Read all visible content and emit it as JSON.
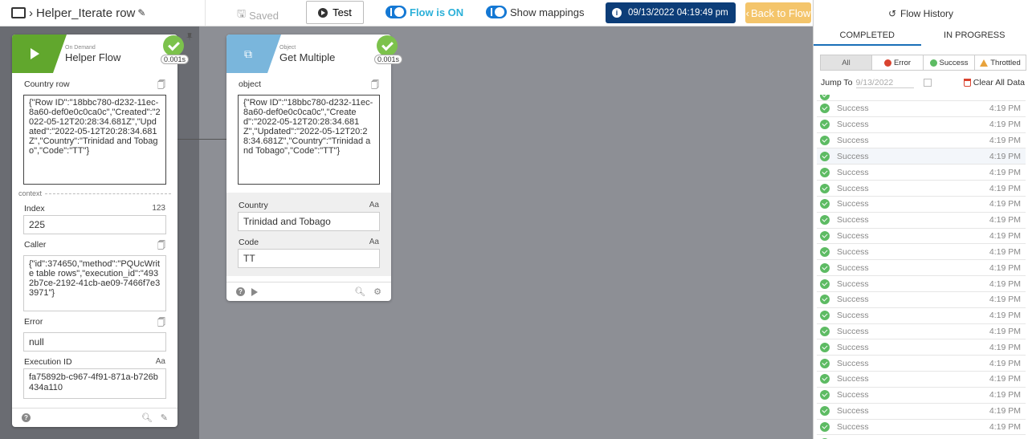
{
  "toolbar": {
    "flow_name": "Helper_Iterate row",
    "saved_label": "Saved",
    "test_label": "Test",
    "flow_on_label": "Flow is ON",
    "show_mappings_label": "Show mappings",
    "timestamp": "09/13/2022 04:19:49 pm",
    "back_label": "Back to Flow"
  },
  "cards": {
    "helper": {
      "subtitle": "On Demand",
      "title": "Helper Flow",
      "duration": "0.001s",
      "country_row_label": "Country row",
      "country_row_value": "{\"Row ID\":\"18bbc780-d232-11ec-8a60-def0e0c0ca0c\",\"Created\":\"2022-05-12T20:28:34.681Z\",\"Updated\":\"2022-05-12T20:28:34.681Z\",\"Country\":\"Trinidad and Tobago\",\"Code\":\"TT\"}",
      "context_label": "context",
      "index_label": "Index",
      "index_type": "123",
      "index_value": "225",
      "caller_label": "Caller",
      "caller_value": "{\"id\":374650,\"method\":\"PQUcWrite table rows\",\"execution_id\":\"4932b7ce-2192-41cb-ae09-7466f7e33971\"}",
      "error_label": "Error",
      "error_value": "null",
      "execution_label": "Execution ID",
      "execution_type": "Aa",
      "execution_value": "fa75892b-c967-4f91-871a-b726b434a110"
    },
    "getmultiple": {
      "subtitle": "Object",
      "title": "Get Multiple",
      "duration": "0.001s",
      "object_label": "object",
      "object_value": "{\"Row ID\":\"18bbc780-d232-11ec-8a60-def0e0c0ca0c\",\"Created\":\"2022-05-12T20:28:34.681Z\",\"Updated\":\"2022-05-12T20:28:34.681Z\",\"Country\":\"Trinidad and Tobago\",\"Code\":\"TT\"}",
      "country_label": "Country",
      "country_type": "Aa",
      "country_value": "Trinidad and Tobago",
      "code_label": "Code",
      "code_type": "Aa",
      "code_value": "TT"
    }
  },
  "history": {
    "title": "Flow History",
    "tab_completed": "COMPLETED",
    "tab_in_progress": "IN PROGRESS",
    "filter_all": "All",
    "filter_error": "Error",
    "filter_success": "Success",
    "filter_throttled": "Throttled",
    "jump_label": "Jump To",
    "jump_date": "9/13/2022",
    "clear_label": "Clear All Data",
    "rows": [
      {
        "status": "Success",
        "time": "4:19 PM"
      },
      {
        "status": "Success",
        "time": "4:19 PM"
      },
      {
        "status": "Success",
        "time": "4:19 PM"
      },
      {
        "status": "Success",
        "time": "4:19 PM"
      },
      {
        "status": "Success",
        "time": "4:19 PM"
      },
      {
        "status": "Success",
        "time": "4:19 PM"
      },
      {
        "status": "Success",
        "time": "4:19 PM"
      },
      {
        "status": "Success",
        "time": "4:19 PM"
      },
      {
        "status": "Success",
        "time": "4:19 PM"
      },
      {
        "status": "Success",
        "time": "4:19 PM"
      },
      {
        "status": "Success",
        "time": "4:19 PM"
      },
      {
        "status": "Success",
        "time": "4:19 PM"
      },
      {
        "status": "Success",
        "time": "4:19 PM"
      },
      {
        "status": "Success",
        "time": "4:19 PM"
      },
      {
        "status": "Success",
        "time": "4:19 PM"
      },
      {
        "status": "Success",
        "time": "4:19 PM"
      },
      {
        "status": "Success",
        "time": "4:19 PM"
      },
      {
        "status": "Success",
        "time": "4:19 PM"
      },
      {
        "status": "Success",
        "time": "4:19 PM"
      },
      {
        "status": "Success",
        "time": "4:19 PM"
      },
      {
        "status": "Success",
        "time": "4:19 PM"
      },
      {
        "status": "Success",
        "time": "4:19 PM"
      }
    ]
  },
  "colors": {
    "navy": "#0c3d78",
    "success_green": "#7cc24c",
    "accent_blue": "#1478d4",
    "back_button": "#f4c56b"
  }
}
